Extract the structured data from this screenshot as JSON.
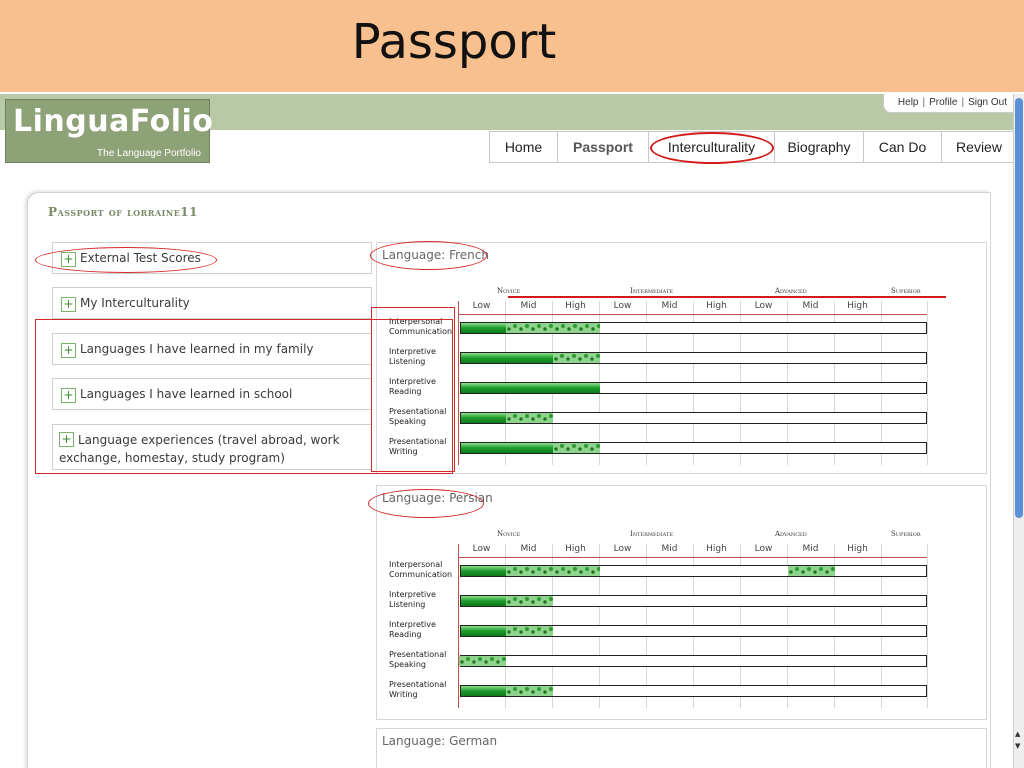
{
  "banner": {
    "title": "Passport"
  },
  "logo": {
    "name": "LinguaFolio",
    "tagline": "The Language Portfolio"
  },
  "top_links": [
    "Help",
    "Profile",
    "Sign Out"
  ],
  "tabs": [
    {
      "label": "Home",
      "active": false
    },
    {
      "label": "Passport",
      "active": true
    },
    {
      "label": "Interculturality",
      "active": false
    },
    {
      "label": "Biography",
      "active": false
    },
    {
      "label": "Can Do",
      "active": false
    },
    {
      "label": "Review",
      "active": false
    }
  ],
  "panel": {
    "title": "Passport of lorraine11"
  },
  "accordion": [
    {
      "label": "External Test Scores"
    },
    {
      "label": "My Interculturality"
    },
    {
      "label": "Languages I have learned in my family"
    },
    {
      "label": "Languages I have learned in school"
    },
    {
      "label": "Language experiences (travel abroad, work exchange, homestay, study program)"
    }
  ],
  "proficiency_levels": [
    "Novice",
    "Intermediate",
    "Advanced",
    "Superior"
  ],
  "sub_levels": [
    "Low",
    "Mid",
    "High",
    "Low",
    "Mid",
    "High",
    "Low",
    "Mid",
    "High"
  ],
  "skills": [
    "Interpersonal Communication",
    "Interpretive Listening",
    "Interpretive Reading",
    "Presentational Speaking",
    "Presentational Writing"
  ],
  "languages": [
    {
      "label": "Language: French",
      "progress": [
        {
          "solid_cells": 1,
          "dotted_cells": 2
        },
        {
          "solid_cells": 2,
          "dotted_cells": 1
        },
        {
          "solid_cells": 3,
          "dotted_cells": 0
        },
        {
          "solid_cells": 1,
          "dotted_cells": 1
        },
        {
          "solid_cells": 2,
          "dotted_cells": 1
        }
      ]
    },
    {
      "label": "Language: Persian",
      "progress": [
        {
          "solid_cells": 1,
          "dotted_cells": 2,
          "extra_dotted_cell": 7
        },
        {
          "solid_cells": 1,
          "dotted_cells": 1
        },
        {
          "solid_cells": 1,
          "dotted_cells": 1
        },
        {
          "solid_cells": 0,
          "dotted_cells": 1
        },
        {
          "solid_cells": 1,
          "dotted_cells": 1
        }
      ]
    },
    {
      "label": "Language: German"
    }
  ],
  "colors": {
    "banner": "#f8c08e",
    "header_green": "#b9c9a6",
    "logo_green": "#8ea278",
    "bar_green": "#1d9a2a",
    "annotation_red": "#d52a2a"
  }
}
